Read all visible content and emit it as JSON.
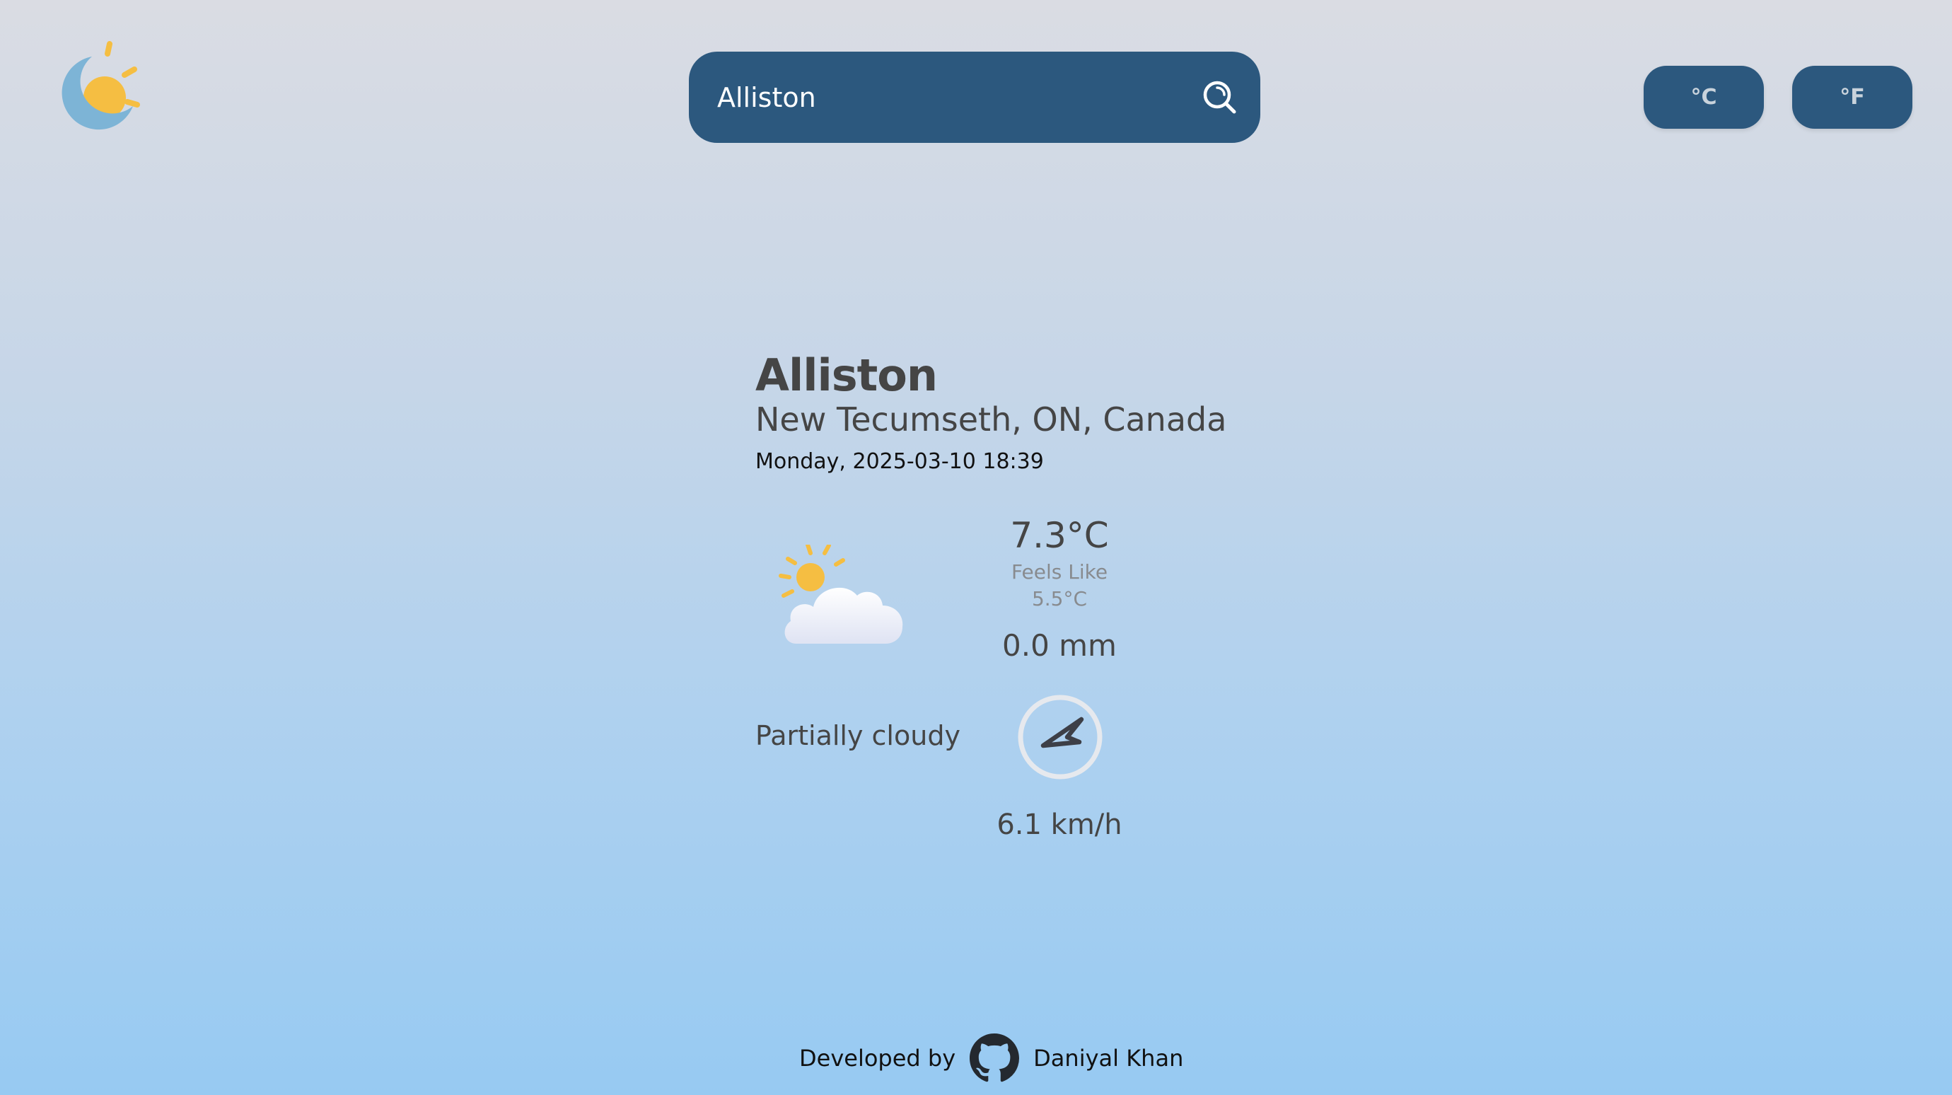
{
  "header": {
    "logo_icon": "moon-sun-logo-icon",
    "search": {
      "value": "Alliston",
      "placeholder": "",
      "icon": "search-icon"
    },
    "units": {
      "celsius_label": "°C",
      "fahrenheit_label": "°F"
    }
  },
  "location": {
    "city": "Alliston",
    "region": "New Tecumseth, ON, Canada",
    "datetime": "Monday, 2025-03-10 18:39"
  },
  "current": {
    "condition_icon": "partly-cloudy-icon",
    "condition": "Partially cloudy",
    "temperature": "7.3°C",
    "feels_like_label": "Feels Like",
    "feels_like_value": "5.5°C",
    "precipitation": "0.0 mm",
    "wind_icon": "wind-direction-arrow-icon",
    "wind_speed": "6.1 km/h"
  },
  "footer": {
    "developed_by": "Developed by",
    "github_icon": "github-icon",
    "author": "Daniyal Khan"
  },
  "colors": {
    "primary": "#2c587e",
    "text": "#454545",
    "muted": "#888b8f",
    "sun": "#f5be42",
    "moon": "#7db4d6"
  }
}
